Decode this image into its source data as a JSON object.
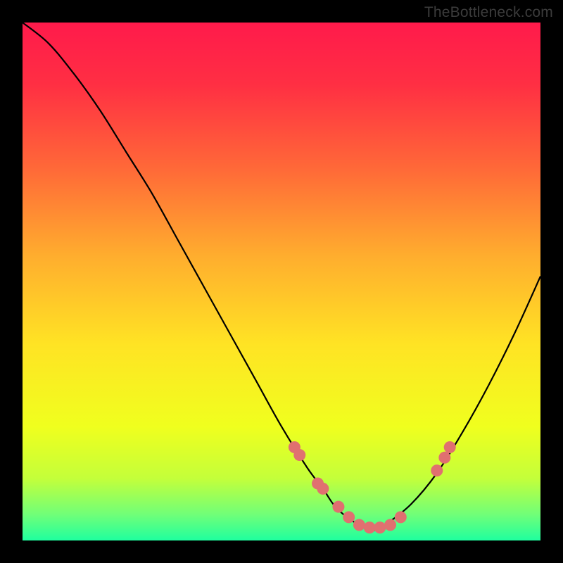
{
  "watermark": "TheBottleneck.com",
  "chart_data": {
    "type": "line",
    "title": "",
    "xlabel": "",
    "ylabel": "",
    "xlim": [
      0,
      100
    ],
    "ylim": [
      0,
      100
    ],
    "curve": {
      "name": "bottleneck-curve",
      "x": [
        0,
        5,
        10,
        15,
        20,
        25,
        30,
        35,
        40,
        45,
        50,
        55,
        58,
        60,
        62,
        65,
        68,
        70,
        75,
        80,
        85,
        90,
        95,
        100
      ],
      "y": [
        100,
        96,
        90,
        83,
        75,
        67,
        58,
        49,
        40,
        31,
        22,
        14,
        10,
        7,
        5,
        3,
        2,
        3,
        7,
        13,
        21,
        30,
        40,
        51
      ]
    },
    "markers": {
      "name": "highlighted-points",
      "x": [
        52.5,
        53.5,
        57,
        58,
        61,
        63,
        65,
        67,
        69,
        71,
        73,
        80,
        81.5,
        82.5
      ],
      "y": [
        18,
        16.5,
        11,
        10,
        6.5,
        4.5,
        3,
        2.5,
        2.5,
        3,
        4.5,
        13.5,
        16,
        18
      ]
    },
    "background": {
      "type": "vertical-gradient",
      "stops": [
        {
          "offset": 0.0,
          "color": "#ff1a4b"
        },
        {
          "offset": 0.12,
          "color": "#ff2f43"
        },
        {
          "offset": 0.28,
          "color": "#ff6838"
        },
        {
          "offset": 0.45,
          "color": "#ffad2e"
        },
        {
          "offset": 0.62,
          "color": "#ffe324"
        },
        {
          "offset": 0.78,
          "color": "#f0ff1e"
        },
        {
          "offset": 0.88,
          "color": "#c4ff3a"
        },
        {
          "offset": 0.95,
          "color": "#70ff78"
        },
        {
          "offset": 1.0,
          "color": "#1fff9f"
        }
      ]
    },
    "marker_color": "#e07070",
    "curve_color": "#000000"
  }
}
